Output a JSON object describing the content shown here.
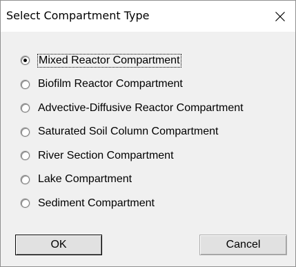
{
  "dialog": {
    "title": "Select Compartment Type",
    "close_icon": "close-icon"
  },
  "options": [
    {
      "label": "Mixed Reactor Compartment",
      "selected": true
    },
    {
      "label": "Biofilm Reactor Compartment",
      "selected": false
    },
    {
      "label": "Advective-Diffusive Reactor Compartment",
      "selected": false
    },
    {
      "label": "Saturated Soil Column Compartment",
      "selected": false
    },
    {
      "label": "River Section Compartment",
      "selected": false
    },
    {
      "label": "Lake Compartment",
      "selected": false
    },
    {
      "label": "Sediment Compartment",
      "selected": false
    }
  ],
  "buttons": {
    "ok_label": "OK",
    "cancel_label": "Cancel"
  }
}
